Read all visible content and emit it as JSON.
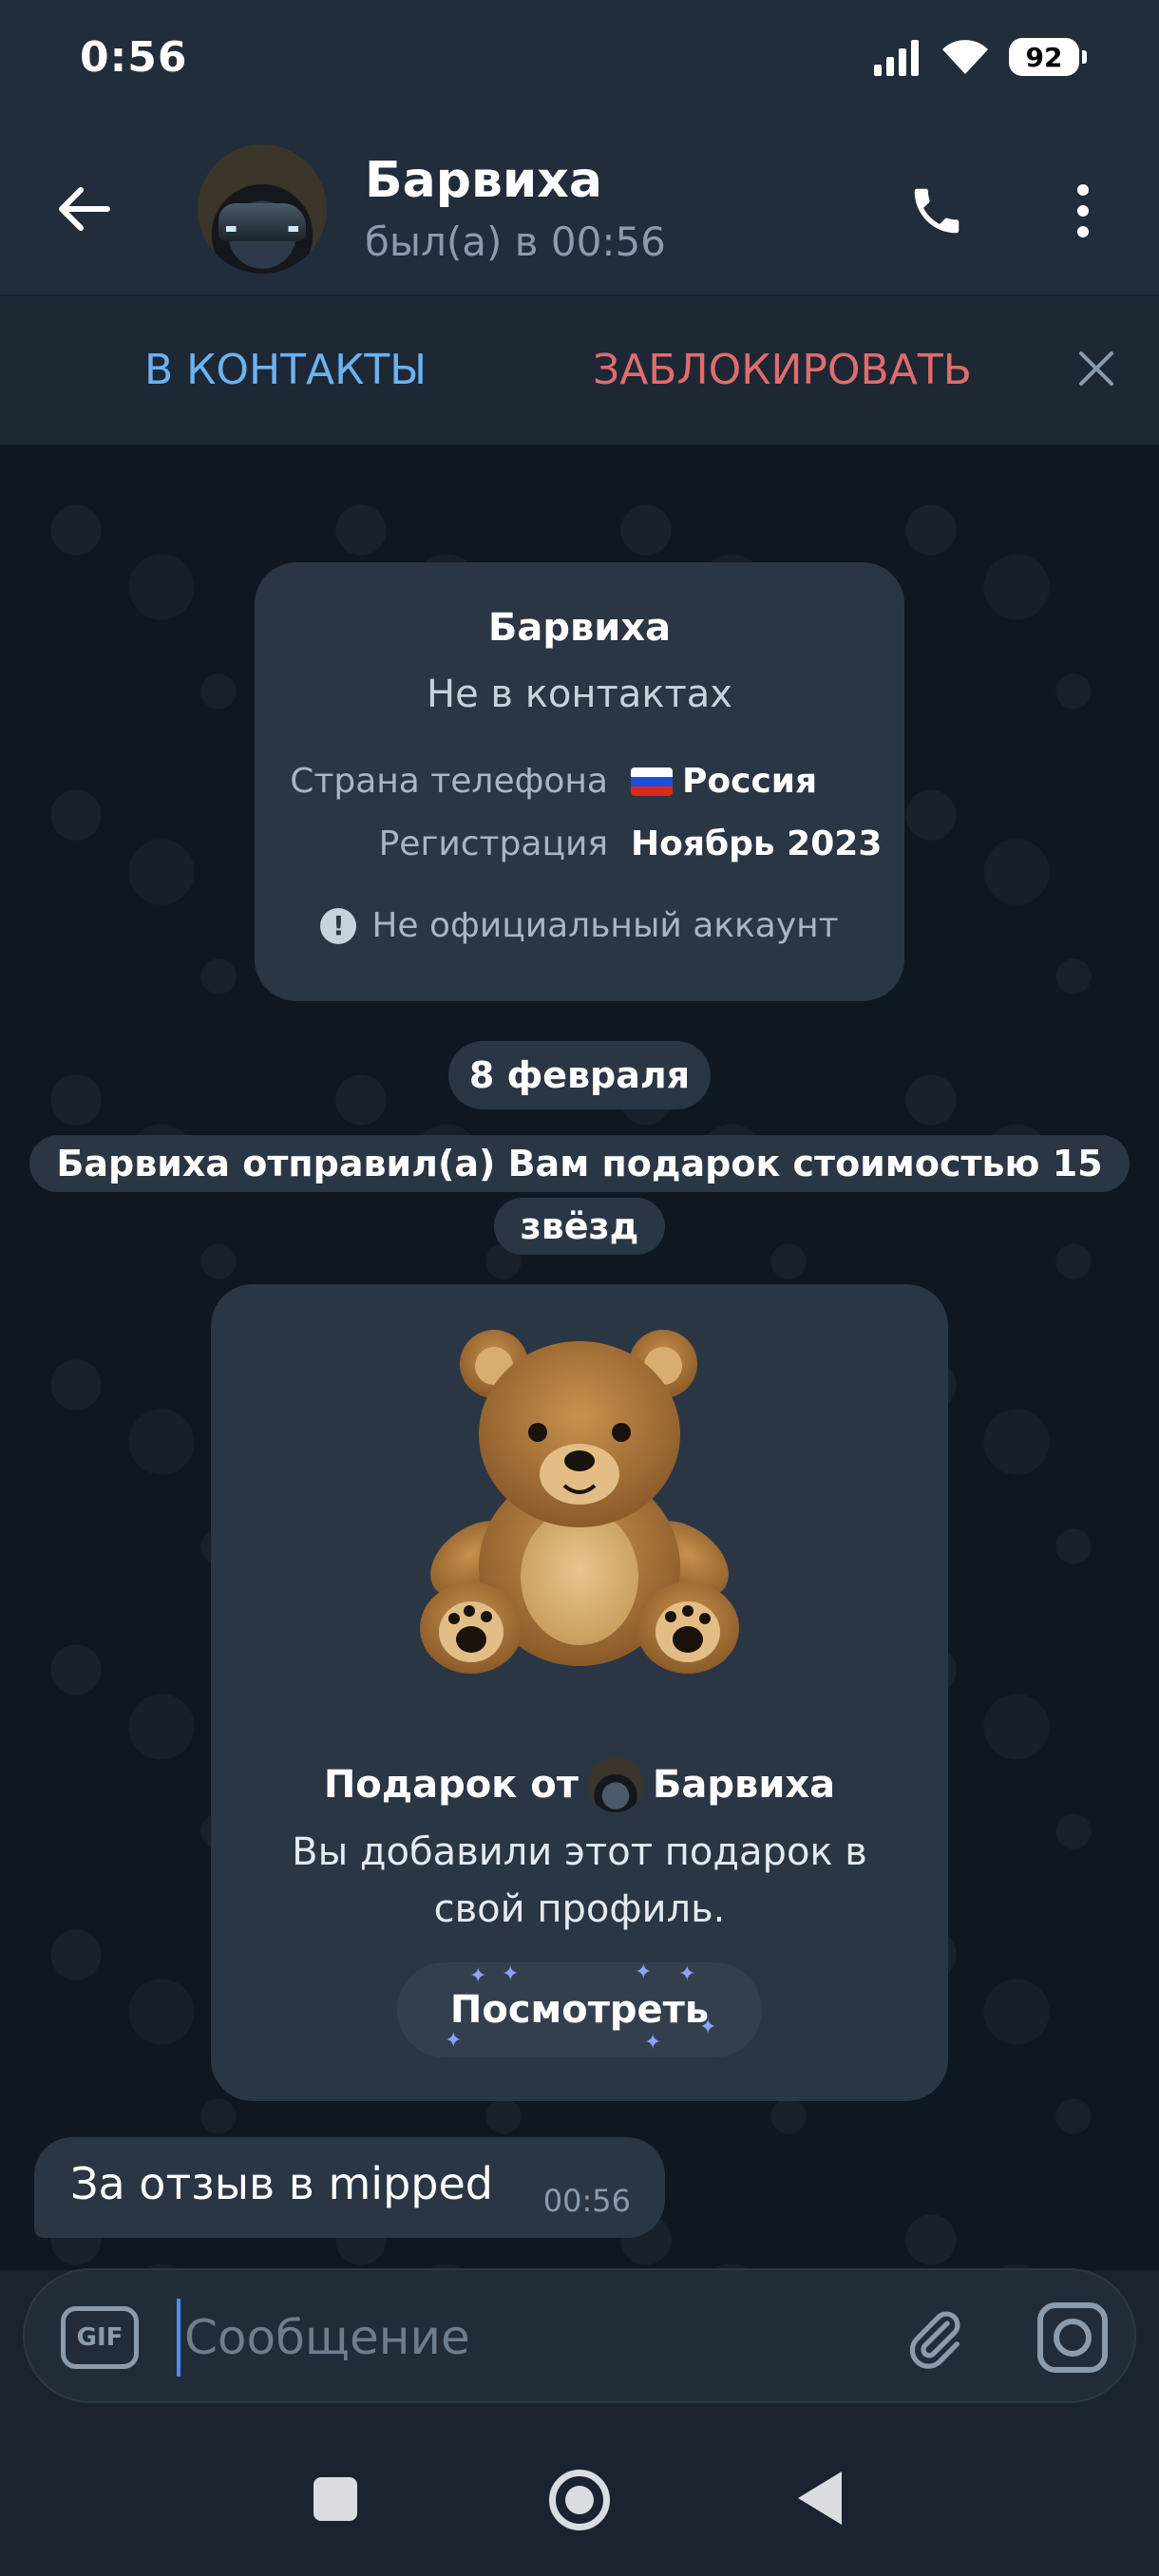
{
  "status_bar": {
    "time": "0:56",
    "battery": "92"
  },
  "header": {
    "name": "Барвиха",
    "status": "был(а) в 00:56"
  },
  "action_bar": {
    "add_contact": "В КОНТАКТЫ",
    "block": "ЗАБЛОКИРОВАТЬ"
  },
  "info_card": {
    "name": "Барвиха",
    "subtitle": "Не в контактах",
    "rows": [
      {
        "label": "Страна телефона",
        "value": "Россия"
      },
      {
        "label": "Регистрация",
        "value": "Ноябрь 2023"
      }
    ],
    "warning": "Не официальный аккаунт"
  },
  "date_separator": "8 февраля",
  "service_message": "Барвиха отправил(а) Вам подарок стоимостью 15 звёзд",
  "gift_card": {
    "title_prefix": "Подарок от",
    "title_name": "Барвиха",
    "description": "Вы добавили этот подарок в свой профиль.",
    "button_label": "Посмотреть"
  },
  "message": {
    "text": "За отзыв в mipped",
    "time": "00:56"
  },
  "composer": {
    "placeholder": "Сообщение",
    "gif_label": "GIF"
  },
  "colors": {
    "accent": "#6ab2f2",
    "danger": "#e06c6c",
    "bubble": "#2b3645",
    "header": "#212d3b"
  }
}
